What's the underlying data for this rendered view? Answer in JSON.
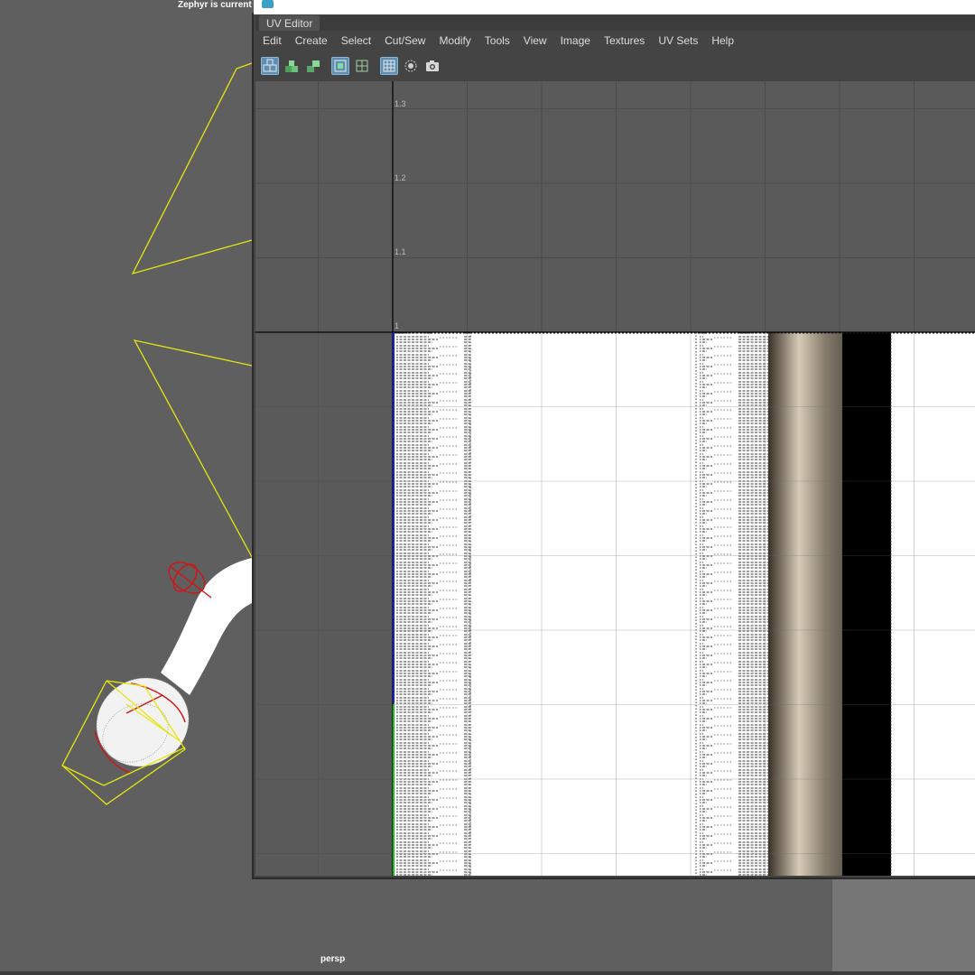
{
  "viewport": {
    "status_text": "Zephyr is current",
    "camera_label": "persp"
  },
  "uv_editor": {
    "title": "UV Editor",
    "menu": [
      "Edit",
      "Create",
      "Select",
      "Cut/Sew",
      "Modify",
      "Tools",
      "View",
      "Image",
      "Textures",
      "UV Sets",
      "Help"
    ],
    "tools": [
      {
        "icon": "uv-shell-select-icon",
        "active": true
      },
      {
        "icon": "uv-shell-move-icon",
        "active": false
      },
      {
        "icon": "uv-shell-stack-icon",
        "active": false
      },
      {
        "icon": "uv-frame-icon",
        "active": true
      },
      {
        "icon": "uv-grid-small-icon",
        "active": false
      },
      {
        "icon": "grid-toggle-icon",
        "active": true
      },
      {
        "icon": "texture-filter-icon",
        "active": false
      },
      {
        "icon": "snapshot-camera-icon",
        "active": false
      }
    ],
    "v_axis_ticks": [
      "1.3",
      "1.2",
      "1.1",
      "1"
    ]
  },
  "colors": {
    "viewport_bg": "#5f5f5f",
    "wireframe_yellow": "#e6e60f",
    "manipulator_red": "#d21414",
    "u_axis_blue": "#1b1bd6",
    "v_axis_green": "#16c016",
    "active_tool": "#5e8fb3"
  }
}
